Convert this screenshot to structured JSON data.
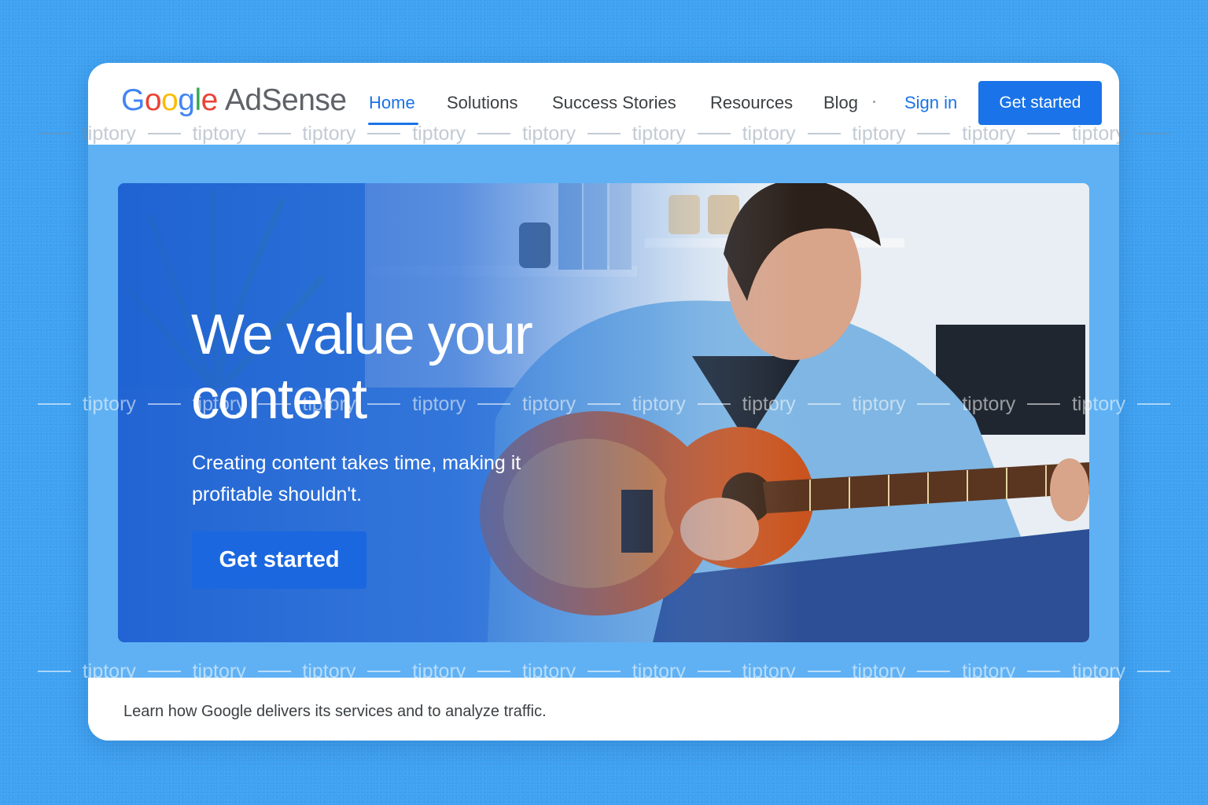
{
  "brand": {
    "google_letters": [
      "G",
      "o",
      "o",
      "g",
      "l",
      "e"
    ],
    "product": "AdSense"
  },
  "nav": {
    "items": [
      {
        "label": "Home",
        "active": true
      },
      {
        "label": "Solutions",
        "active": false
      },
      {
        "label": "Success Stories",
        "active": false
      },
      {
        "label": "Resources",
        "active": false
      },
      {
        "label": "Blog",
        "active": false
      }
    ],
    "sign_in": "Sign in",
    "cta": "Get started"
  },
  "hero": {
    "title": "We value your content",
    "subtitle": "Creating content takes time, making it profitable shouldn't.",
    "cta": "Get started"
  },
  "footer": {
    "notice": "Learn how Google delivers its services and to analyze traffic."
  },
  "watermark": {
    "text": "tiptory"
  },
  "colors": {
    "background": "#3fa2f2",
    "accent": "#1a73e8",
    "google_blue": "#4285f4",
    "google_red": "#ea4335",
    "google_yellow": "#fbbc05",
    "google_green": "#34a853"
  }
}
